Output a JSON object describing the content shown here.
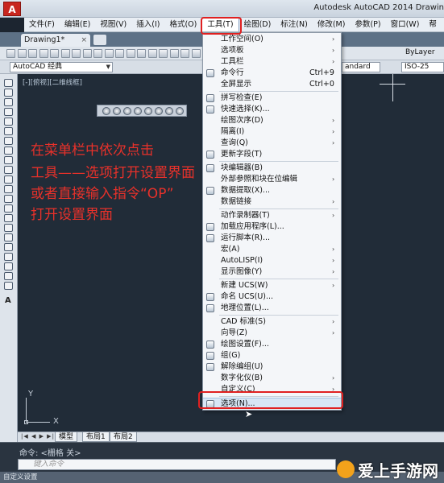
{
  "window": {
    "title": "Autodesk AutoCAD 2014    Drawin",
    "logo": "A"
  },
  "menu": {
    "items": [
      "文件(F)",
      "编辑(E)",
      "视图(V)",
      "插入(I)",
      "格式(O)",
      "工具(T)",
      "绘图(D)",
      "标注(N)",
      "修改(M)",
      "参数(P)",
      "窗口(W)",
      "帮"
    ],
    "active_index": 5
  },
  "document_tab": {
    "label": "Drawing1*",
    "close": "×"
  },
  "toolbar": {
    "workspace": "AutoCAD 经典",
    "text_style": "andard",
    "dim_style": "ISO-25",
    "lineweight": "ByLayer"
  },
  "canvas": {
    "viewport_label": "[-][俯视][二维线框]",
    "background": "#212c38"
  },
  "annotation": {
    "color": "#e8312a",
    "lines": [
      "在菜单栏中依次点击",
      "工具——选项打开设置界面",
      "或者直接输入指令“OP”",
      "打开设置界面"
    ]
  },
  "ucs": {
    "x": "X",
    "y": "Y"
  },
  "layout_tabs": [
    "模型",
    "布局1",
    "布局2"
  ],
  "command": {
    "history": "命令:  <栅格 关>",
    "placeholder": "键入命令"
  },
  "status_bar": {
    "text": "自定义设置"
  },
  "tools_menu": {
    "items": [
      {
        "label": "工作空间(O)",
        "arrow": true,
        "icon": null
      },
      {
        "label": "选项板",
        "arrow": true,
        "icon": null
      },
      {
        "label": "工具栏",
        "arrow": true,
        "icon": null
      },
      {
        "label": "命令行",
        "shortcut": "Ctrl+9",
        "icon": "command-line-icon"
      },
      {
        "label": "全屏显示",
        "shortcut": "Ctrl+0",
        "icon": null
      },
      {
        "label": "拼写检查(E)",
        "icon": "spell-check-icon"
      },
      {
        "label": "快速选择(K)...",
        "icon": "quick-select-icon"
      },
      {
        "label": "绘图次序(D)",
        "arrow": true,
        "icon": null
      },
      {
        "label": "隔离(I)",
        "arrow": true,
        "icon": null
      },
      {
        "label": "查询(Q)",
        "arrow": true,
        "icon": null
      },
      {
        "label": "更新字段(T)",
        "icon": "update-field-icon"
      },
      {
        "label": "块编辑器(B)",
        "icon": "block-editor-icon"
      },
      {
        "label": "外部参照和块在位编辑",
        "arrow": true,
        "icon": null
      },
      {
        "label": "数据提取(X)...",
        "icon": "data-extraction-icon"
      },
      {
        "label": "数据链接",
        "arrow": true,
        "icon": null
      },
      {
        "label": "动作录制器(T)",
        "arrow": true,
        "icon": null
      },
      {
        "label": "加载应用程序(L)...",
        "icon": "load-application-icon"
      },
      {
        "label": "运行脚本(R)...",
        "icon": "run-script-icon"
      },
      {
        "label": "宏(A)",
        "arrow": true,
        "icon": null
      },
      {
        "label": "AutoLISP(I)",
        "arrow": true,
        "icon": null
      },
      {
        "label": "显示图像(Y)",
        "arrow": true,
        "icon": null
      },
      {
        "label": "新建 UCS(W)",
        "arrow": true,
        "icon": null
      },
      {
        "label": "命名 UCS(U)...",
        "icon": "named-ucs-icon"
      },
      {
        "label": "地理位置(L)...",
        "icon": "geolocation-icon"
      },
      {
        "label": "CAD 标准(S)",
        "arrow": true,
        "icon": null
      },
      {
        "label": "向导(Z)",
        "arrow": true,
        "icon": null
      },
      {
        "label": "绘图设置(F)...",
        "icon": "drafting-settings-icon"
      },
      {
        "label": "组(G)",
        "icon": "group-icon"
      },
      {
        "label": "解除编组(U)",
        "icon": "ungroup-icon"
      },
      {
        "label": "数字化仪(B)",
        "arrow": true,
        "icon": null
      },
      {
        "label": "自定义(C)",
        "arrow": true,
        "icon": null
      },
      {
        "label": "选项(N)...",
        "icon": "options-icon",
        "highlighted": true
      }
    ]
  },
  "watermark": {
    "text": "爱上手游网"
  }
}
